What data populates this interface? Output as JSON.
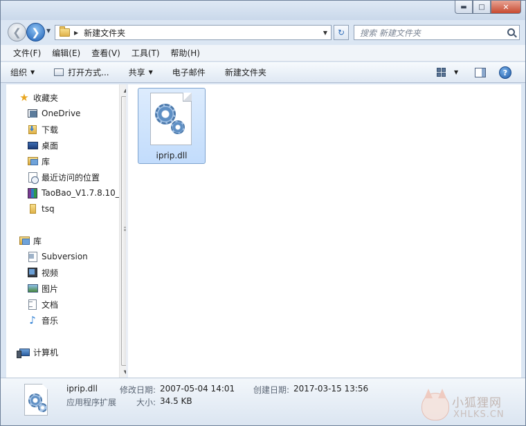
{
  "window": {
    "caption_buttons": {
      "minimize": "▬",
      "maximize": "□",
      "close": "✕"
    }
  },
  "address_bar": {
    "back_glyph": "❮",
    "forward_glyph": "❯",
    "path": "新建文件夹",
    "refresh_glyph": "↻"
  },
  "search": {
    "placeholder": "搜索 新建文件夹"
  },
  "menu": {
    "items": [
      "文件(F)",
      "编辑(E)",
      "查看(V)",
      "工具(T)",
      "帮助(H)"
    ]
  },
  "toolbar": {
    "organize": "组织",
    "open_with": "打开方式...",
    "share": "共享",
    "email": "电子邮件",
    "new_folder": "新建文件夹",
    "help": "?"
  },
  "nav": {
    "favorites": {
      "label": "收藏夹",
      "items": [
        "OneDrive",
        "下载",
        "桌面",
        "库",
        "最近访问的位置",
        "TaoBao_V1.7.8.10_",
        "tsq"
      ]
    },
    "libraries": {
      "label": "库",
      "items": [
        "Subversion",
        "视频",
        "图片",
        "文档",
        "音乐"
      ]
    },
    "computer": {
      "label": "计算机"
    }
  },
  "files": [
    {
      "name": "iprip.dll",
      "selected": true,
      "icon": "system-file-gear-icon"
    }
  ],
  "details": {
    "filename": "iprip.dll",
    "type": "应用程序扩展",
    "modified_label": "修改日期:",
    "modified_value": "2007-05-04 14:01",
    "size_label": "大小:",
    "size_value": "34.5 KB",
    "created_label": "创建日期:",
    "created_value": "2017-03-15 13:56"
  },
  "watermark": {
    "cn": "小狐狸网",
    "en": "XHLKS.CN"
  },
  "colors": {
    "accent": "#1d5fb5",
    "selection": "#cce4fc",
    "frame": "#dbe6f3"
  }
}
